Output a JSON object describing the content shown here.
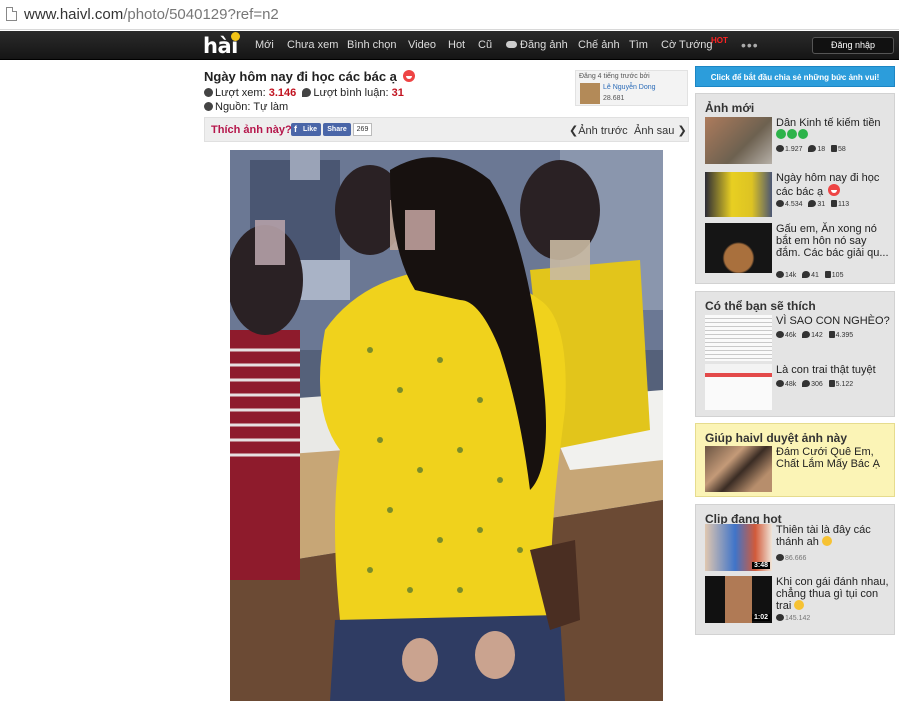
{
  "browser": {
    "url_host": "www.haivl.com",
    "url_path": "/photo/5040129?ref=n2"
  },
  "nav": {
    "logo": "hài",
    "items": [
      "Mới",
      "Chưa xem",
      "Bình chọn",
      "Video",
      "Hot",
      "Cũ",
      "Đăng ảnh",
      "Chế ảnh",
      "Tìm",
      "Cờ Tướng"
    ],
    "hot_badge": "HOT",
    "more": "•••",
    "login": "Đăng nhập"
  },
  "post": {
    "title": "Ngày hôm nay đi học các bác ạ",
    "views_label": "Lượt xem:",
    "views": "3.146",
    "comments_label": "Lượt bình luận:",
    "comments": "31",
    "source_label": "Nguồn:",
    "source": "Tự làm",
    "uploader": {
      "time": "Đăng 4 tiếng trước bởi",
      "name": "Lê Nguyễn Dong",
      "points": "28.681"
    },
    "like_prompt": "Thích ảnh này?",
    "fb_like": "Like",
    "fb_share": "Share",
    "fb_count": "269",
    "prev": "Ảnh trước",
    "next": "Ảnh sau"
  },
  "sidebar": {
    "cta": "Click để bắt đầu chia sẻ những bức ảnh vui!",
    "new_title": "Ảnh mới",
    "new_items": [
      {
        "title": "Dân Kinh tế kiếm tiền",
        "views": "1.927",
        "comments": "18",
        "likes": "58"
      },
      {
        "title": "Ngày hôm nay đi học các bác ạ",
        "views": "4.534",
        "comments": "31",
        "likes": "113"
      },
      {
        "title": "Gấu em, Ăn xong nó bắt em hôn nó say đắm. Các bác giải qu...",
        "views": "14k",
        "comments": "41",
        "likes": "105"
      }
    ],
    "like_title": "Có thể bạn sẽ thích",
    "like_items": [
      {
        "title": "VÌ SAO CON NGHÈO?",
        "views": "46k",
        "comments": "142",
        "likes": "4.395"
      },
      {
        "title": "Là con trai thật tuyệt",
        "views": "48k",
        "comments": "306",
        "likes": "5.122"
      }
    ],
    "help_title": "Giúp haivl duyệt ảnh này",
    "help_item": "Đám Cưới Quê Em, Chất Lắm Mấy Bác Ạ",
    "clip_title": "Clip đang hot",
    "clips": [
      {
        "title": "Thiên tài là đây các thánh ah",
        "duration": "3:48",
        "views": "86.666"
      },
      {
        "title": "Khi con gái đánh nhau, chẳng thua gì tụi con trai",
        "duration": "1:02",
        "views": "145.142"
      }
    ]
  }
}
